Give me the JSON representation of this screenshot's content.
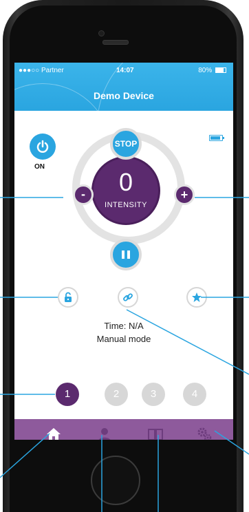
{
  "status_bar": {
    "carrier": "●●●○○ Partner",
    "time": "14:07",
    "battery": "80%"
  },
  "header": {
    "title": "Demo Device"
  },
  "controls": {
    "stop_label": "STOP",
    "power_label": "ON",
    "intensity_value": "0",
    "intensity_label": "INTENSITY",
    "minus_label": "-",
    "plus_label": "+"
  },
  "info": {
    "time_text": "Time: N/A",
    "mode_text": "Manual mode"
  },
  "modes": [
    {
      "label": "1",
      "active": true
    },
    {
      "label": "2",
      "active": false
    },
    {
      "label": "3",
      "active": false
    },
    {
      "label": "4",
      "active": false
    }
  ],
  "tabs": [
    {
      "icon": "home-icon"
    },
    {
      "icon": "user-icon"
    },
    {
      "icon": "book-icon"
    },
    {
      "icon": "gears-icon"
    }
  ],
  "colors": {
    "accent_blue": "#2aa5e0",
    "accent_purple": "#5b2a6e",
    "tabbar_purple": "#8e5a9c",
    "inactive_gray": "#d7d7d7"
  }
}
